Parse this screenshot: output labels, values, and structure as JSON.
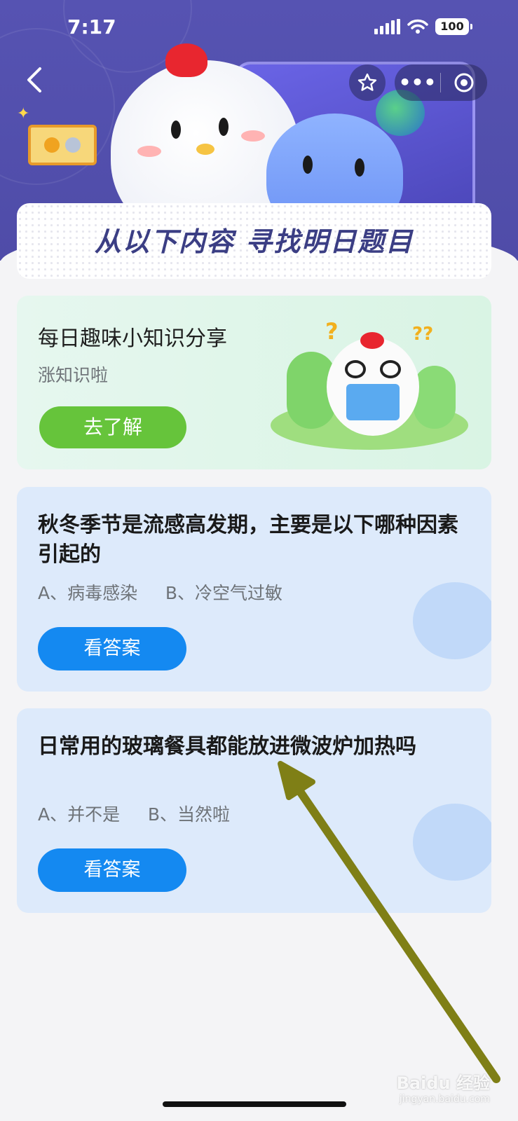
{
  "status_bar": {
    "time": "7:17",
    "battery": "100"
  },
  "header": {
    "banner_title": "从以下内容 寻找明日题目"
  },
  "knowledge_card": {
    "title": "每日趣味小知识分享",
    "subtitle": "涨知识啦",
    "button_label": "去了解"
  },
  "questions": [
    {
      "title": "秋冬季节是流感高发期，主要是以下哪种因素引起的",
      "options": "A、病毒感染     B、冷空气过敏",
      "button_label": "看答案"
    },
    {
      "title": "日常用的玻璃餐具都能放进微波炉加热吗",
      "options": "A、并不是     B、当然啦",
      "button_label": "看答案"
    }
  ],
  "watermark": {
    "text": "Baidu 经验",
    "sub": "jingyan.baidu.com"
  },
  "colors": {
    "header_bg": "#5653b2",
    "green_button": "#66c43b",
    "blue_button": "#1489f1",
    "annotation_arrow": "#7f7f16"
  }
}
